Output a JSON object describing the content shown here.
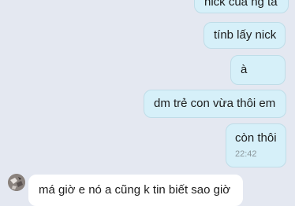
{
  "messages": [
    {
      "direction": "outgoing",
      "text": "nick của ng ta"
    },
    {
      "direction": "outgoing",
      "text": "tínb lấy nick"
    },
    {
      "direction": "outgoing",
      "text": "à"
    },
    {
      "direction": "outgoing",
      "text": "dm trẻ con vừa thôi em"
    },
    {
      "direction": "outgoing",
      "text": "còn thôi",
      "time": "22:42"
    },
    {
      "direction": "incoming",
      "text": "má giờ e nó a cũng k tin biết sao giờ"
    }
  ],
  "colors": {
    "background": "#e4e8f1",
    "outgoing_bubble": "#d6f0f9",
    "outgoing_border": "#bfdde8",
    "incoming_bubble": "#ffffff",
    "timestamp": "#8c979c"
  }
}
